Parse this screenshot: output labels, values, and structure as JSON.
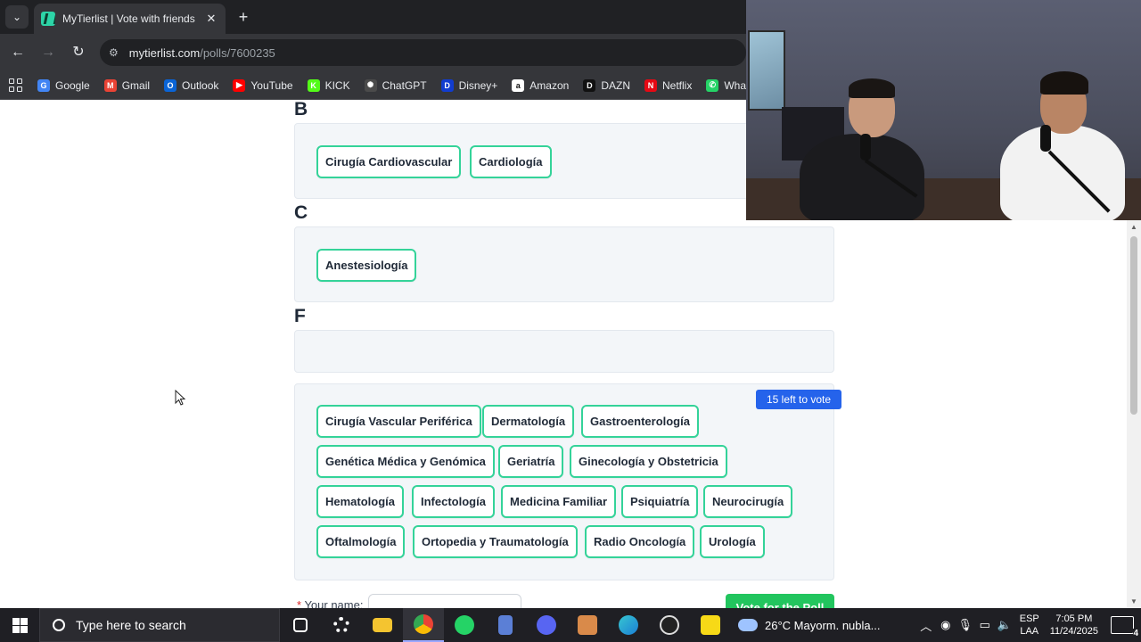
{
  "browser": {
    "tab_title": "MyTierlist | Vote with friends",
    "tab_close": "✕",
    "new_tab": "+",
    "url_host": "mytierlist.com",
    "url_path": "/polls/7600235",
    "bookmarks": [
      {
        "label": "Google",
        "color": "#4285f4",
        "glyph": "G"
      },
      {
        "label": "Gmail",
        "color": "#ea4335",
        "glyph": "M"
      },
      {
        "label": "Outlook",
        "color": "#0a64d6",
        "glyph": "O"
      },
      {
        "label": "YouTube",
        "color": "#ff0000",
        "glyph": "▶"
      },
      {
        "label": "KICK",
        "color": "#53fc18",
        "glyph": "K"
      },
      {
        "label": "ChatGPT",
        "color": "#4b4b4b",
        "glyph": "✺"
      },
      {
        "label": "Disney+",
        "color": "#113ccf",
        "glyph": "D"
      },
      {
        "label": "Amazon",
        "color": "#ffffff",
        "glyph": "a"
      },
      {
        "label": "DAZN",
        "color": "#111111",
        "glyph": "D"
      },
      {
        "label": "Netflix",
        "color": "#e50914",
        "glyph": "N"
      },
      {
        "label": "WhatsAp",
        "color": "#25d366",
        "glyph": "✆"
      }
    ]
  },
  "tiers": [
    {
      "label": "B",
      "items": [
        "Cirugía Cardiovascular",
        "Cardiología"
      ]
    },
    {
      "label": "C",
      "items": [
        "Anestesiología"
      ]
    },
    {
      "label": "F",
      "items": []
    }
  ],
  "pool": {
    "badge": "15 left to vote",
    "rows": [
      [
        "Cirugía Vascular Periférica",
        "Dermatología",
        "Gastroenterología"
      ],
      [
        "Genética Médica y Genómica",
        "Geriatría",
        "Ginecología y Obstetricia"
      ],
      [
        "Hematología",
        "Infectología",
        "Medicina Familiar",
        "Psiquiatría",
        "Neurocirugía"
      ],
      [
        "Oftalmología",
        "Ortopedia y Traumatología",
        "Radio Oncología",
        "Urología"
      ]
    ]
  },
  "form": {
    "name_label": "Your name:",
    "required_mark": "*",
    "vote_button": "Vote for the Poll"
  },
  "taskbar": {
    "search_placeholder": "Type here to search",
    "weather": "26°C  Mayorm. nubla...",
    "lang_top": "ESP",
    "lang_bottom": "LAA",
    "time": "7:05 PM",
    "date": "11/24/2025",
    "notifications": "4"
  },
  "colors": {
    "chip_border": "#34d399",
    "badge": "#2563eb",
    "vote_button": "#22c55e"
  }
}
